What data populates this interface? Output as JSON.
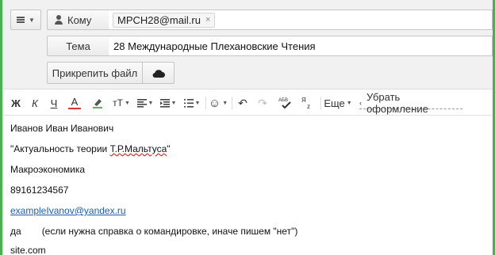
{
  "compose": {
    "to_label": "Кому",
    "recipient": "MPCH28@mail.ru",
    "recipient_remove": "×",
    "subject_label": "Тема",
    "subject_value": "28 Международные Плехановские Чтения",
    "attach_label": "Прикрепить файл"
  },
  "toolbar": {
    "bold": "Ж",
    "italic": "К",
    "underline": "Ч",
    "text_color": "А",
    "font_size": "тТ",
    "more": "Еще",
    "clear_format": "Убрать оформление",
    "spell": "АБВ",
    "translit": "Я"
  },
  "body": {
    "lines": [
      "Иванов Иван Иванович",
      "\"Актуальность теории ",
      "Т.Р.Мальтуса",
      "\"",
      "Макроэкономика",
      "89161234567",
      "exampleIvanov@yandex.ru",
      "да",
      "(если нужна справка о командировке, иначе пишем \"нет\")",
      "site.com"
    ]
  },
  "colors": {
    "accent_border": "#4caf50",
    "link": "#1a5fb4",
    "text_color_icon": "#d33",
    "highlight_icon": "#6a6"
  }
}
